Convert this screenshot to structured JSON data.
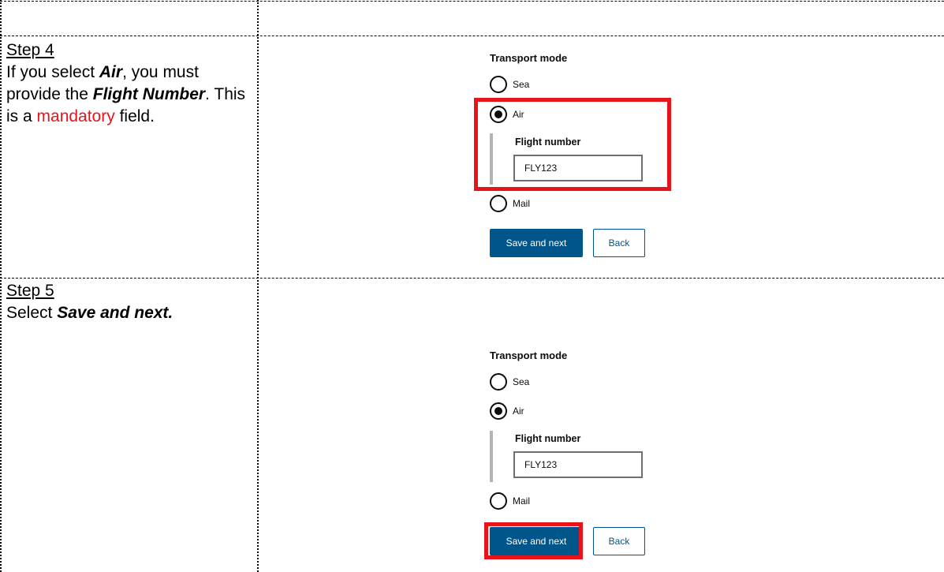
{
  "steps": [
    {
      "title": "Step 4",
      "text": {
        "p1": "If you select ",
        "air": "Air",
        "p2": ", you must provide the ",
        "flight": "Flight Number",
        "p3": ". This is a ",
        "mandatory": "mandatory",
        "p4": " field."
      },
      "form": {
        "legend": "Transport mode",
        "options": [
          "Sea",
          "Air",
          "Mail"
        ],
        "selected": "Air",
        "field_label": "Flight number",
        "field_value": "FLY123",
        "save_label": "Save and next",
        "back_label": "Back"
      },
      "highlight_target": "flight-number-section"
    },
    {
      "title": "Step 5",
      "text": {
        "p1": "Select ",
        "action": "Save and next."
      },
      "form": {
        "legend": "Transport mode",
        "options": [
          "Sea",
          "Air",
          "Mail"
        ],
        "selected": "Air",
        "field_label": "Flight number",
        "field_value": "FLY123",
        "save_label": "Save and next",
        "back_label": "Back"
      },
      "highlight_target": "save-and-next-button"
    }
  ],
  "colors": {
    "highlight": "#e8141b",
    "primary_button": "#00568a",
    "mandatory_text": "#e8141b"
  }
}
